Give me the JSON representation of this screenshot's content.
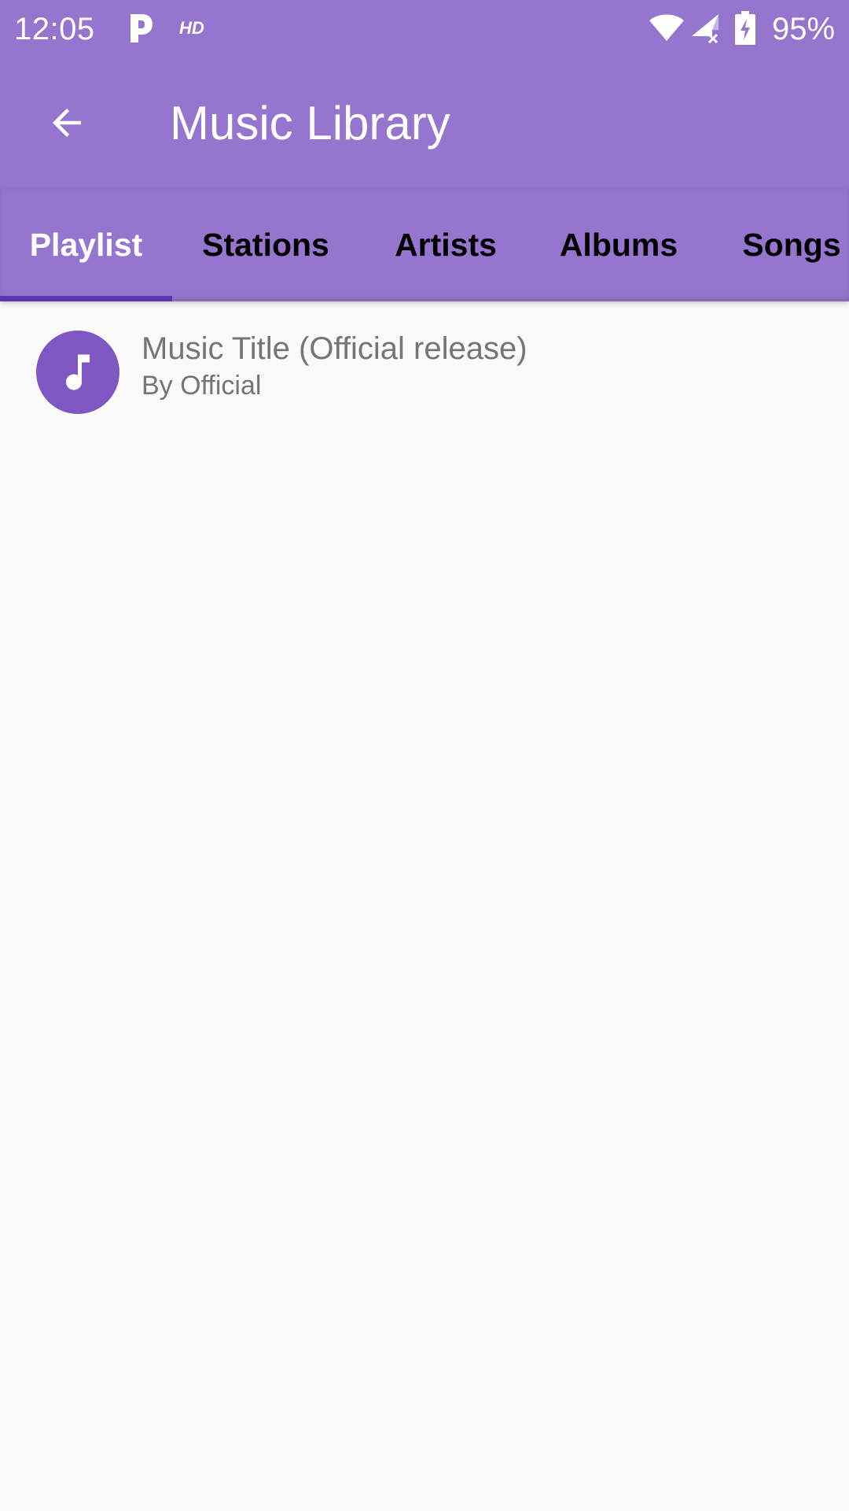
{
  "status_bar": {
    "time": "12:05",
    "hd_label": "HD",
    "battery_percent": "95%",
    "icons": [
      "p-app-icon",
      "wifi-icon",
      "cell-signal-no-data-icon",
      "battery-charging-icon"
    ]
  },
  "app_bar": {
    "back_icon": "arrow-back-icon",
    "title": "Music Library"
  },
  "tabs": [
    {
      "label": "Playlist",
      "active": true
    },
    {
      "label": "Stations",
      "active": false
    },
    {
      "label": "Artists",
      "active": false
    },
    {
      "label": "Albums",
      "active": false
    },
    {
      "label": "Songs",
      "active": false
    }
  ],
  "list": {
    "items": [
      {
        "icon": "music-note-icon",
        "title": "Music Title (Official release)",
        "subtitle": "By Official"
      }
    ]
  },
  "colors": {
    "primary": "#9575cd",
    "tab_indicator": "#5e35b1",
    "avatar": "#7e57c2",
    "background": "#fafafa",
    "secondary_text": "#757575"
  }
}
